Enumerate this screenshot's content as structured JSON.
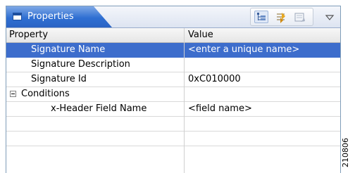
{
  "view": {
    "title": "Properties",
    "tab_icon": "properties-view-icon",
    "toolbar": [
      {
        "name": "show-categories-button",
        "icon": "tree-categories-icon",
        "active": true
      },
      {
        "name": "show-advanced-button",
        "icon": "filter-advanced-icon",
        "active": false
      },
      {
        "name": "restore-defaults-button",
        "icon": "restore-default-icon",
        "active": false
      }
    ],
    "view_menu_icon": "chevron-down-icon"
  },
  "table": {
    "headers": {
      "property": "Property",
      "value": "Value"
    },
    "rows": [
      {
        "property": "Signature Name",
        "value": "<enter a unique name>",
        "selected": true
      },
      {
        "property": "Signature Description",
        "value": ""
      },
      {
        "property": "Signature Id",
        "value": "0xC010000"
      },
      {
        "property": "Conditions",
        "value": "",
        "expandable": true,
        "expanded": true
      },
      {
        "property": "x-Header Field Name",
        "value": "<field name>"
      },
      {
        "property": "",
        "value": ""
      },
      {
        "property": "",
        "value": ""
      }
    ]
  },
  "figure_id": "210806",
  "colors": {
    "tab_blue": "#2f6fd2",
    "selection": "#3d6dcc",
    "border": "#7f9db9"
  }
}
